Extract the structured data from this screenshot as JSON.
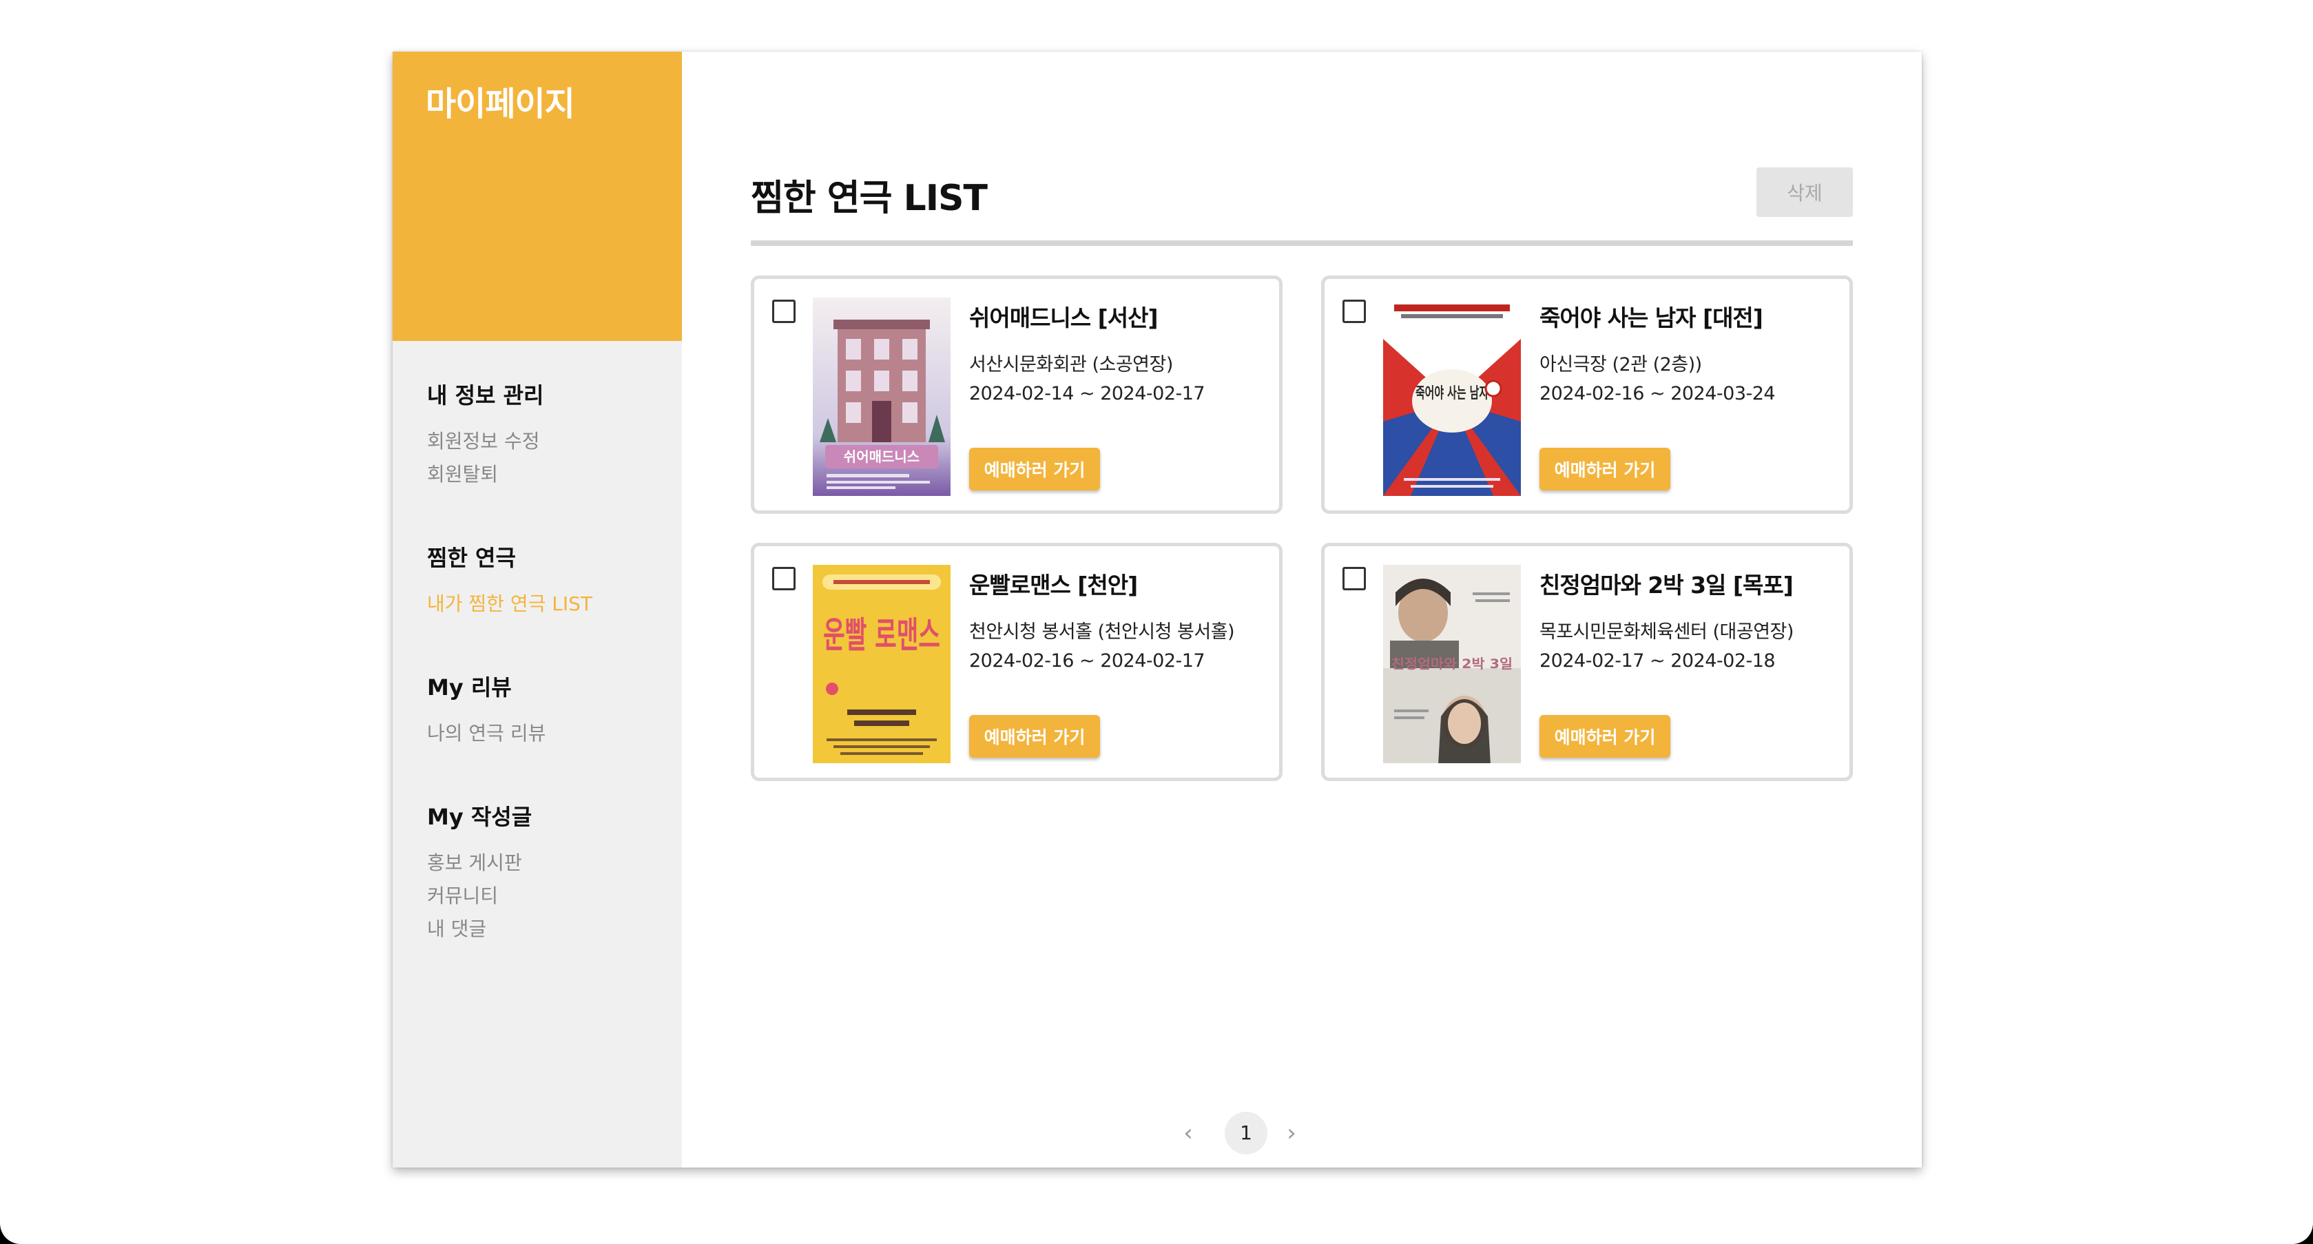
{
  "sidebar": {
    "title": "마이페이지",
    "groups": [
      {
        "title": "내 정보 관리",
        "links": [
          {
            "label": "회원정보 수정"
          },
          {
            "label": "회원탈퇴"
          }
        ]
      },
      {
        "title": "찜한 연극",
        "links": [
          {
            "label": "내가 찜한 연극 LIST",
            "active": true
          }
        ]
      },
      {
        "title": "My 리뷰",
        "links": [
          {
            "label": "나의 연극 리뷰"
          }
        ]
      },
      {
        "title": "My 작성글",
        "links": [
          {
            "label": "홍보 게시판"
          },
          {
            "label": "커뮤니티"
          },
          {
            "label": "내 댓글"
          }
        ]
      }
    ]
  },
  "main": {
    "title": "찜한 연극 LIST",
    "delete_label": "삭제",
    "book_label": "예매하러 가기",
    "cards": [
      {
        "title": "쉬어매드니스 [서산]",
        "venue": "서산시문화회관 (소공연장)",
        "dates": "2024-02-14 ~ 2024-02-17",
        "poster_text": "쉬어매드니스"
      },
      {
        "title": "죽어야 사는 남자 [대전]",
        "venue": "아신극장 (2관 (2층))",
        "dates": "2024-02-16 ~ 2024-03-24",
        "poster_text": "죽어야 사는 남자"
      },
      {
        "title": "운빨로맨스 [천안]",
        "venue": "천안시청 봉서홀 (천안시청 봉서홀)",
        "dates": "2024-02-16 ~ 2024-02-17",
        "poster_text": "운빨 로맨스"
      },
      {
        "title": "친정엄마와 2박 3일 [목포]",
        "venue": "목포시민문화체육센터 (대공연장)",
        "dates": "2024-02-17 ~ 2024-02-18",
        "poster_text": "친정엄마와 2박 3일"
      }
    ]
  },
  "pagination": {
    "prev": "‹",
    "current": "1",
    "next": "›"
  },
  "colors": {
    "accent": "#f3b43c",
    "sidebar_bg": "#f0f0f0",
    "muted": "#888888"
  }
}
